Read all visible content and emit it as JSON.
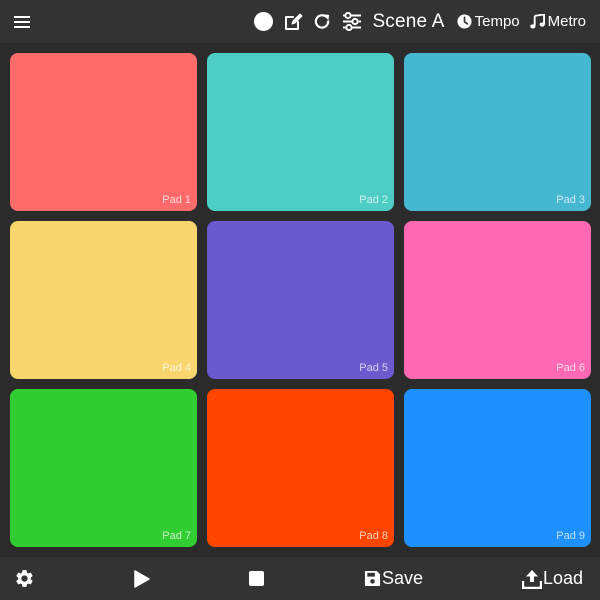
{
  "header": {
    "menu_icon": "hamburger-menu-icon",
    "record_icon": "record-circle-icon",
    "edit_icon": "edit-pencil-icon",
    "redo_icon": "redo-arrow-icon",
    "mixer_icon": "sliders-icon",
    "scene_title": "Scene A",
    "tempo": {
      "icon": "clock-icon",
      "label": "Tempo"
    },
    "metro": {
      "icon": "music-note-icon",
      "label": "Metro"
    }
  },
  "pads": [
    {
      "label": "Pad 1",
      "color": "#ff6b6b"
    },
    {
      "label": "Pad 2",
      "color": "#4ecdc4"
    },
    {
      "label": "Pad 3",
      "color": "#45b7d1"
    },
    {
      "label": "Pad 4",
      "color": "#f9d56e"
    },
    {
      "label": "Pad 5",
      "color": "#6a5acd"
    },
    {
      "label": "Pad 6",
      "color": "#ff69b4"
    },
    {
      "label": "Pad 7",
      "color": "#32cd32"
    },
    {
      "label": "Pad 8",
      "color": "#ff4500"
    },
    {
      "label": "Pad 9",
      "color": "#1e90ff"
    }
  ],
  "footer": {
    "settings_icon": "gear-icon",
    "play_icon": "play-icon",
    "stop_icon": "stop-icon",
    "save": {
      "icon": "floppy-disk-icon",
      "label": "Save"
    },
    "load": {
      "icon": "upload-icon",
      "label": "Load"
    }
  },
  "colors": {
    "background": "#2b2b2b",
    "bar": "#333333",
    "icon": "#ffffff"
  }
}
